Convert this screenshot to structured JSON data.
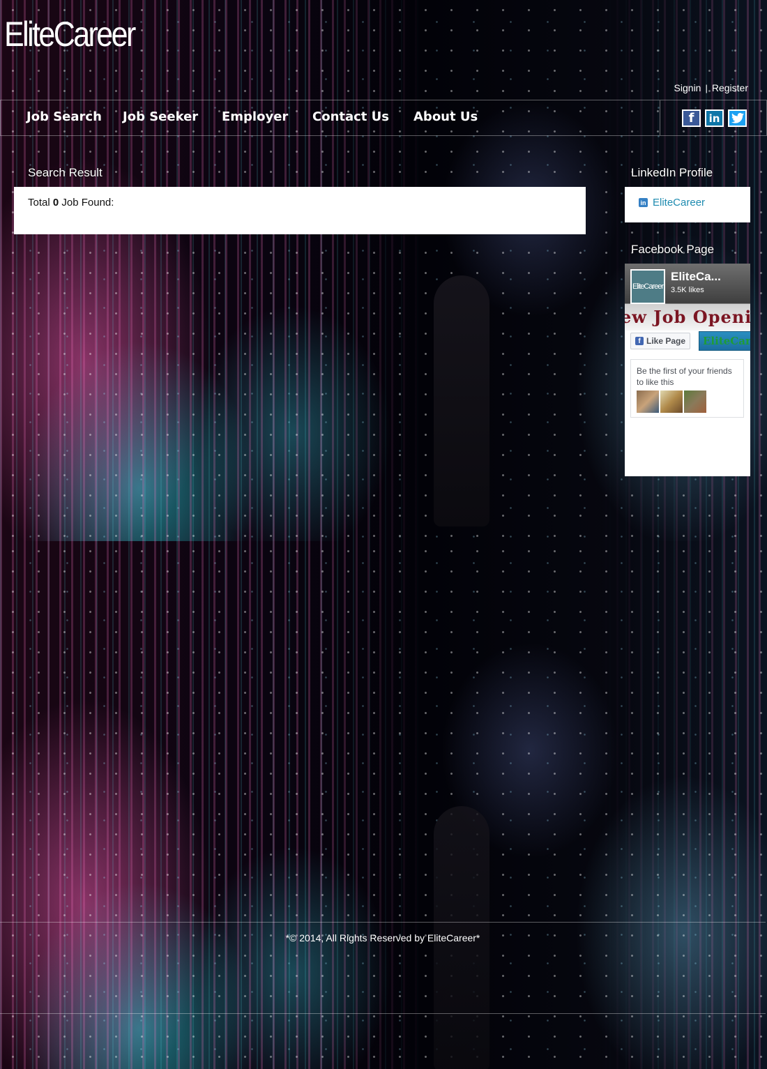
{
  "brand": {
    "logo": "EliteCareer"
  },
  "auth": {
    "signin": "Signin",
    "separator": "|",
    "register": "Register"
  },
  "nav": {
    "items": [
      {
        "label": "Job Search"
      },
      {
        "label": "Job Seeker"
      },
      {
        "label": "Employer"
      },
      {
        "label": "Contact Us"
      },
      {
        "label": "About Us"
      }
    ]
  },
  "social": {
    "facebook": {
      "icon": "facebook-icon",
      "glyph": "f",
      "color": "#3b5998"
    },
    "linkedin": {
      "icon": "linkedin-icon",
      "glyph": "in",
      "color": "#0e76a8"
    },
    "twitter": {
      "icon": "twitter-icon",
      "color": "#1da1f2"
    }
  },
  "search": {
    "title": "Search Result",
    "total_prefix": "Total",
    "count": "0",
    "total_suffix": "Job Found:"
  },
  "sidebar": {
    "linkedin": {
      "title": "LinkedIn Profile",
      "icon_glyph": "in",
      "link": "EliteCareer"
    },
    "facebook": {
      "title": "Facebook Page",
      "page_name": "EliteCa...",
      "avatar_text": "EliteCareer",
      "likes": "3.5K likes",
      "banner": "ew Job Openi",
      "like_button": "Like Page",
      "like_icon": "f",
      "ribbon": "EliteCar",
      "friends_text": "Be the first of your friends to like this"
    }
  },
  "footer": {
    "copyright": "*© 2014, All Rights Reserved by EliteCareer*"
  }
}
